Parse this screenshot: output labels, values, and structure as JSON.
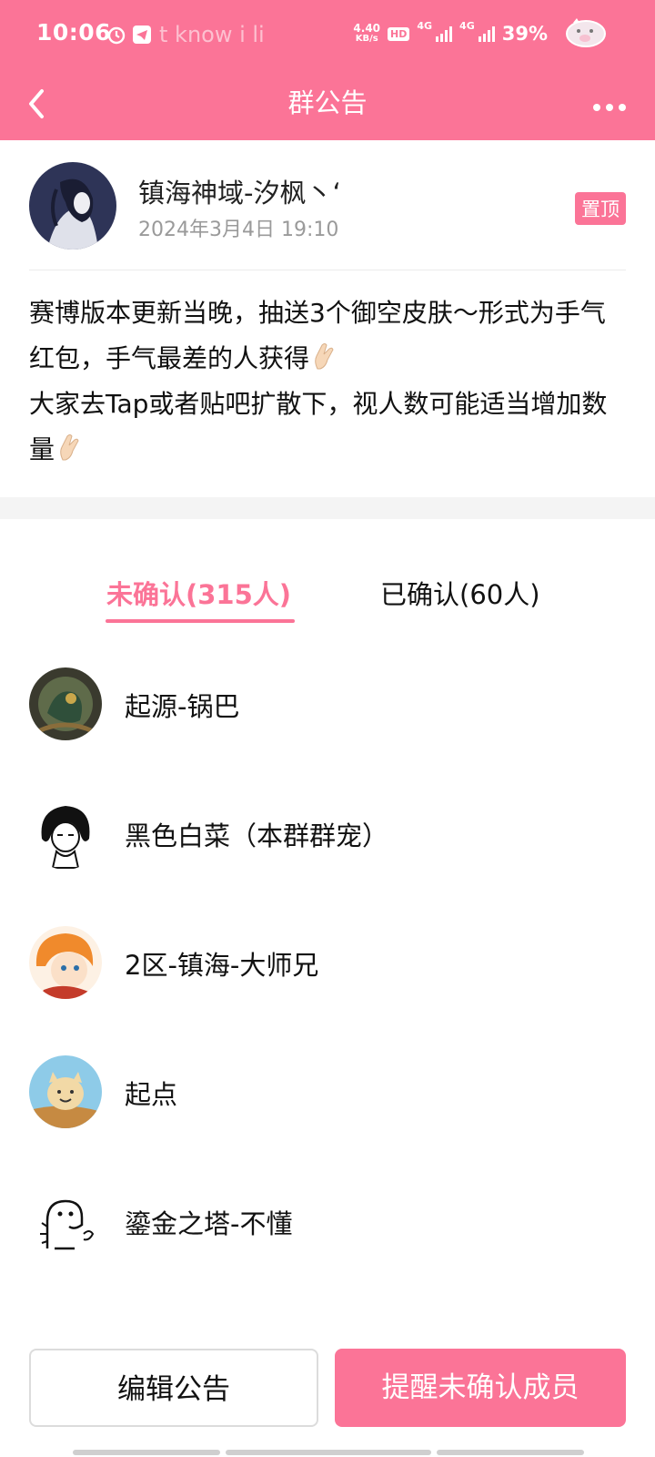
{
  "status_bar": {
    "time": "10:06",
    "notification_text": "t know i li",
    "net_speed_value": "4.40",
    "net_speed_unit": "KB/s",
    "hd_label": "HD",
    "net1": "4G",
    "net2": "4G",
    "battery": "39%"
  },
  "nav": {
    "title": "群公告"
  },
  "announcement": {
    "author": "镇海神域-汐枫丶ʻ",
    "time": "2024年3月4日 19:10",
    "pin_label": "置顶",
    "lines": [
      "赛博版本更新当晚，抽送3个御空皮肤～形式为手气红包，手气最差的人获得",
      "大家去Tap或者贴吧扩散下，视人数可能适当增加数量"
    ]
  },
  "tabs": {
    "unconfirmed": "未确认(315人)",
    "confirmed": "已确认(60人)"
  },
  "members": [
    {
      "name": "起源-锅巴"
    },
    {
      "name": "黑色白菜（本群群宠）"
    },
    {
      "name": "2区-镇海-大师兄"
    },
    {
      "name": "起点"
    },
    {
      "name": "鎏金之塔-不懂"
    }
  ],
  "buttons": {
    "edit": "编辑公告",
    "remind": "提醒未确认成员"
  },
  "colors": {
    "accent": "#fb7497",
    "secondary_text": "#9a9a9a"
  }
}
